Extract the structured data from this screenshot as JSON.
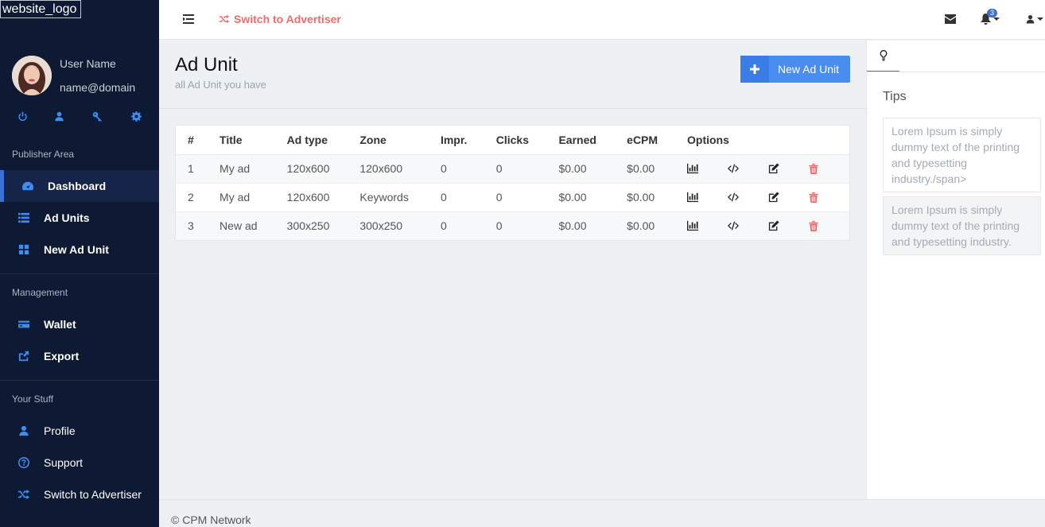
{
  "sidebar": {
    "logo_alt": "website_logo",
    "user_name": "User Name",
    "user_email": "name@domain",
    "quick_icons": [
      "power-icon",
      "user-icon",
      "key-icon",
      "gear-icon"
    ],
    "sections": [
      {
        "label": "Publisher Area",
        "items": [
          {
            "label": "Dashboard",
            "icon": "dashboard-icon",
            "active": true
          },
          {
            "label": "Ad Units",
            "icon": "list-icon"
          },
          {
            "label": "New Ad Unit",
            "icon": "grid-icon"
          }
        ]
      },
      {
        "label": "Management",
        "items": [
          {
            "label": "Wallet",
            "icon": "credit-card-icon"
          },
          {
            "label": "Export",
            "icon": "share-icon"
          }
        ]
      },
      {
        "label": "Your Stuff",
        "items": [
          {
            "label": "Profile",
            "icon": "user-icon"
          },
          {
            "label": "Support",
            "icon": "question-icon"
          },
          {
            "label": "Switch to Advertiser",
            "icon": "shuffle-icon"
          }
        ]
      }
    ]
  },
  "topbar": {
    "switch_label": "Switch to Advertiser",
    "notifications_count": "3",
    "accent": "#f06c6c"
  },
  "page": {
    "title": "Ad Unit",
    "subtitle": "all Ad Unit you have",
    "new_button": "New Ad Unit"
  },
  "table": {
    "headers": [
      "#",
      "Title",
      "Ad type",
      "Zone",
      "Impr.",
      "Clicks",
      "Earned",
      "eCPM",
      "Options"
    ],
    "rows": [
      [
        "1",
        "My ad",
        "120x600",
        "120x600",
        "0",
        "0",
        "$0.00",
        "$0.00"
      ],
      [
        "2",
        "My ad",
        "120x600",
        "Keywords",
        "0",
        "0",
        "$0.00",
        "$0.00"
      ],
      [
        "3",
        "New ad",
        "300x250",
        "300x250",
        "0",
        "0",
        "$0.00",
        "$0.00"
      ]
    ]
  },
  "tips": {
    "title": "Tips",
    "items": [
      "Lorem Ipsum is simply dummy text of the printing and typesetting industry./span>",
      "Lorem Ipsum is simply dummy text of the printing and typesetting industry."
    ]
  },
  "footer": {
    "copyright": "© CPM Network"
  },
  "colors": {
    "sidebar_bg": "#0e1a33",
    "accent_blue": "#3d8ef0",
    "danger": "#e06b6b"
  }
}
